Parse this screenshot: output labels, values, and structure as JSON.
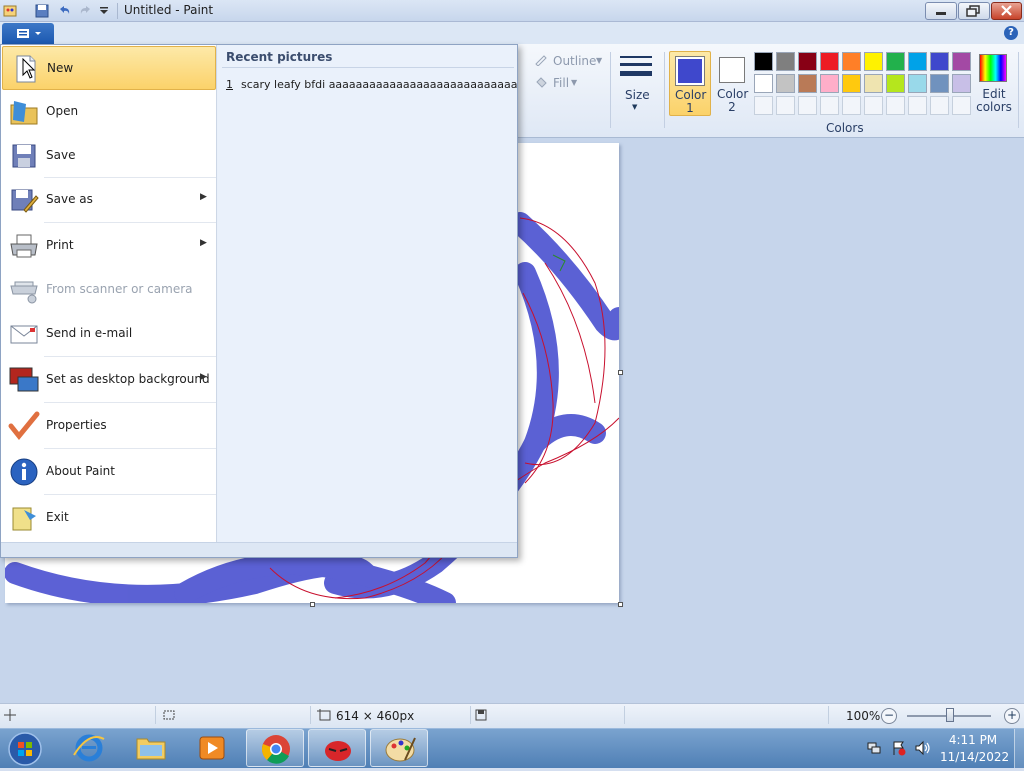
{
  "window": {
    "title": "Untitled - Paint"
  },
  "file_menu": {
    "items": [
      {
        "label": "New",
        "icon": "new-document-icon",
        "arrow": ""
      },
      {
        "label": "Open",
        "icon": "open-folder-icon",
        "arrow": ""
      },
      {
        "label": "Save",
        "icon": "save-disk-icon",
        "arrow": ""
      },
      {
        "label": "Save as",
        "icon": "save-as-icon",
        "arrow": "▶"
      },
      {
        "label": "Print",
        "icon": "printer-icon",
        "arrow": "▶"
      },
      {
        "label": "From scanner or camera",
        "icon": "scanner-icon",
        "arrow": ""
      },
      {
        "label": "Send in e-mail",
        "icon": "email-icon",
        "arrow": ""
      },
      {
        "label": "Set as desktop background",
        "icon": "desktop-background-icon",
        "arrow": "▶"
      },
      {
        "label": "Properties",
        "icon": "checkmark-icon",
        "arrow": ""
      },
      {
        "label": "About Paint",
        "icon": "info-icon",
        "arrow": ""
      },
      {
        "label": "Exit",
        "icon": "exit-icon",
        "arrow": ""
      }
    ],
    "recent_title": "Recent pictures",
    "recent_items": [
      {
        "index": "1",
        "name": "scary leafy bfdi aaaaaaaaaaaaaaaaaaaaaaaaaaaaaaaaaaaa"
      }
    ]
  },
  "ribbon": {
    "outline_label": "Outline",
    "fill_label": "Fill",
    "size_label": "Size",
    "color1_label": "Color 1",
    "color2_label": "Color 2",
    "edit_colors_label": "Edit colors",
    "colors_group_label": "Colors",
    "color1_value": "#3f48cc",
    "color2_value": "#ffffff",
    "palette_row1": [
      "#000000",
      "#7f7f7f",
      "#880015",
      "#ed1c24",
      "#ff7f27",
      "#fff200",
      "#22b14c",
      "#00a2e8",
      "#3f48cc",
      "#a349a4"
    ],
    "palette_row2": [
      "#ffffff",
      "#c3c3c3",
      "#b97a57",
      "#ffaec9",
      "#ffc90e",
      "#efe4b0",
      "#b5e61d",
      "#99d9ea",
      "#7092be",
      "#c8bfe7"
    ]
  },
  "status": {
    "canvas_size": "614 × 460px",
    "zoom": "100%"
  },
  "taskbar": {
    "time": "4:11 PM",
    "date": "11/14/2022"
  }
}
